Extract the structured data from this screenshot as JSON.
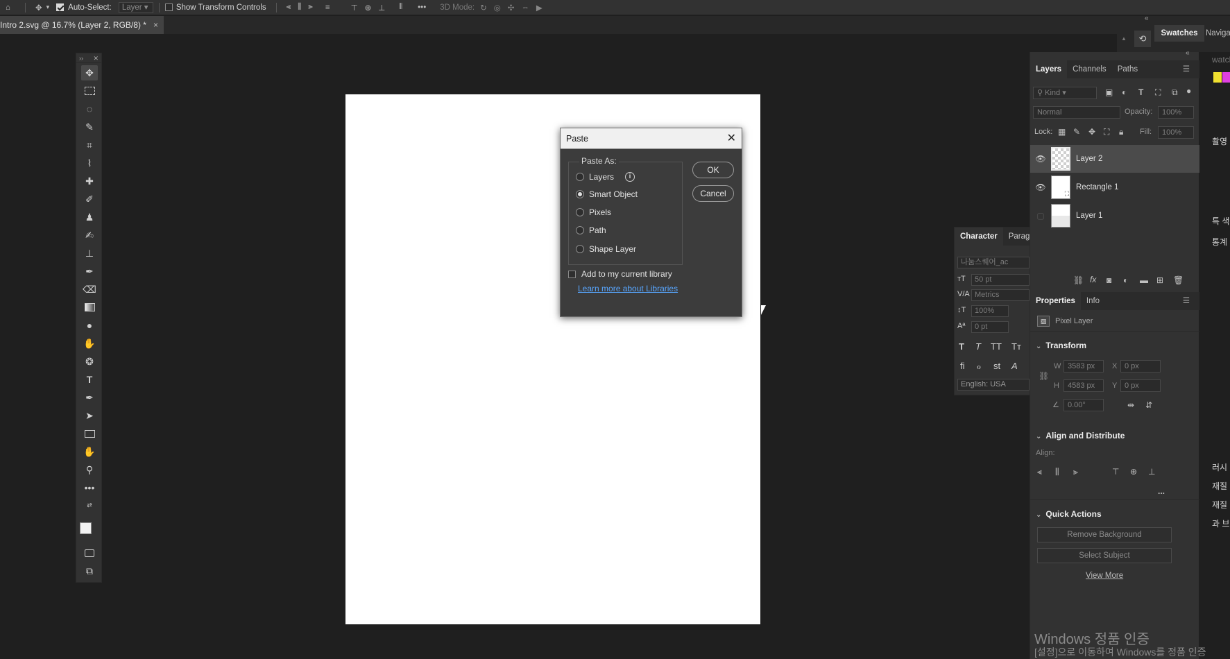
{
  "options_bar": {
    "auto_select_label": "Auto-Select:",
    "auto_select_target": "Layer",
    "show_transform_label": "Show Transform Controls",
    "mode_3d_label": "3D Mode:"
  },
  "document_tab": {
    "title": "Intro 2.svg @ 16.7% (Layer 2, RGB/8) *",
    "close": "×"
  },
  "right_top": {
    "swatches_tab": "Swatches",
    "navigator_tab": "Navigat",
    "swatch_search_text": "watch",
    "swatch_colors": [
      "#f0e030",
      "#e040e0"
    ]
  },
  "paste_dialog": {
    "title": "Paste",
    "close": "✕",
    "group_label": "Paste As:",
    "options": [
      "Layers",
      "Smart Object",
      "Pixels",
      "Path",
      "Shape Layer"
    ],
    "selected_option": "Smart Object",
    "info_glyph": "i",
    "ok_label": "OK",
    "cancel_label": "Cancel",
    "library_checkbox_label": "Add to my current library",
    "library_checked": false,
    "learn_link": "Learn more about Libraries"
  },
  "character_panel": {
    "tab_character": "Character",
    "tab_paragraph": "Paragr",
    "font_name": "나눔스퀘어_ac",
    "font_size": "50 pt",
    "kerning": "Metrics",
    "vertical_scale": "100%",
    "baseline": "0 pt",
    "language": "English: USA"
  },
  "layers_panel": {
    "tabs": [
      "Layers",
      "Channels",
      "Paths"
    ],
    "filter_kind": "Kind",
    "blend_mode": "Normal",
    "opacity_label": "Opacity:",
    "opacity_value": "100%",
    "lock_label": "Lock:",
    "fill_label": "Fill:",
    "fill_value": "100%",
    "layers": [
      {
        "name": "Layer 2",
        "visible": true,
        "selected": true
      },
      {
        "name": "Rectangle 1",
        "visible": true,
        "selected": false
      },
      {
        "name": "Layer 1",
        "visible": false,
        "selected": false
      }
    ]
  },
  "properties_panel": {
    "tabs": [
      "Properties",
      "Info"
    ],
    "layer_type": "Pixel Layer",
    "transform_title": "Transform",
    "w_label": "W",
    "w_value": "3583 px",
    "h_label": "H",
    "h_value": "4583 px",
    "x_label": "X",
    "x_value": "0 px",
    "y_label": "Y",
    "y_value": "0 px",
    "angle_value": "0.00°",
    "align_title": "Align and Distribute",
    "align_label": "Align:",
    "more": "...",
    "quick_actions_title": "Quick Actions",
    "remove_bg": "Remove Background",
    "select_subject": "Select Subject",
    "view_more": "View More"
  },
  "far_right_text": [
    "촬영",
    "특 색",
    "통계",
    "러시",
    "재질",
    "재질",
    "과 브"
  ],
  "watermark": {
    "line1": "Windows 정품 인증",
    "line2": "[설정]으로 이동하여 Windows를 정품 인증"
  }
}
